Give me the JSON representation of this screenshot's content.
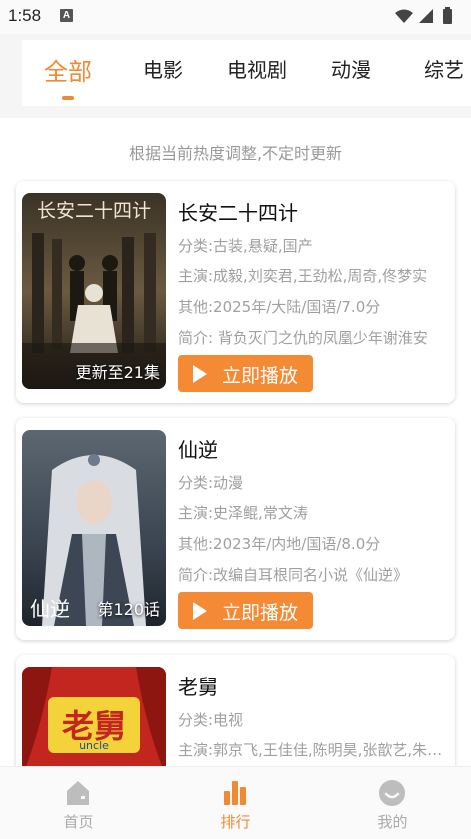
{
  "status_bar": {
    "time": "1:58",
    "notification_badge": "A"
  },
  "tabs": [
    {
      "label": "全部",
      "active": true
    },
    {
      "label": "电影",
      "active": false
    },
    {
      "label": "电视剧",
      "active": false
    },
    {
      "label": "动漫",
      "active": false
    },
    {
      "label": "综艺",
      "active": false
    }
  ],
  "notice": "根据当前热度调整,不定时更新",
  "play_label": "立即播放",
  "items": [
    {
      "title": "长安二十四计",
      "badge": "更新至21集",
      "poster_title": "长安二十四计",
      "category": "分类:古装,悬疑,国产",
      "cast": "主演:成毅,刘奕君,王劲松,周奇,佟梦实",
      "other": "其他:2025年/大陆/国语/7.0分",
      "intro": "简介:        背负灭门之仇的凤凰少年谢淮安"
    },
    {
      "title": "仙逆",
      "badge": "第120话",
      "poster_title": "仙逆",
      "category": "分类:动漫",
      "cast": "主演:史泽鲲,常文涛",
      "other": "其他:2023年/内地/国语/8.0分",
      "intro": "简介:改编自耳根同名小说《仙逆》"
    },
    {
      "title": "老舅",
      "badge": "",
      "poster_title": "老舅",
      "poster_subtitle": "uncle",
      "category": "分类:电视",
      "cast": "主演:郭京飞,王佳佳,陈明昊,张歆艺,朱时茂",
      "other": "",
      "intro": ""
    }
  ],
  "bottom_nav": [
    {
      "label": "首页",
      "icon": "home-icon",
      "active": false
    },
    {
      "label": "排行",
      "icon": "ranking-icon",
      "active": true
    },
    {
      "label": "我的",
      "icon": "profile-icon",
      "active": false
    }
  ],
  "colors": {
    "accent": "#f08a33",
    "button": "#f58a34",
    "muted_text": "#a0a0a0"
  }
}
